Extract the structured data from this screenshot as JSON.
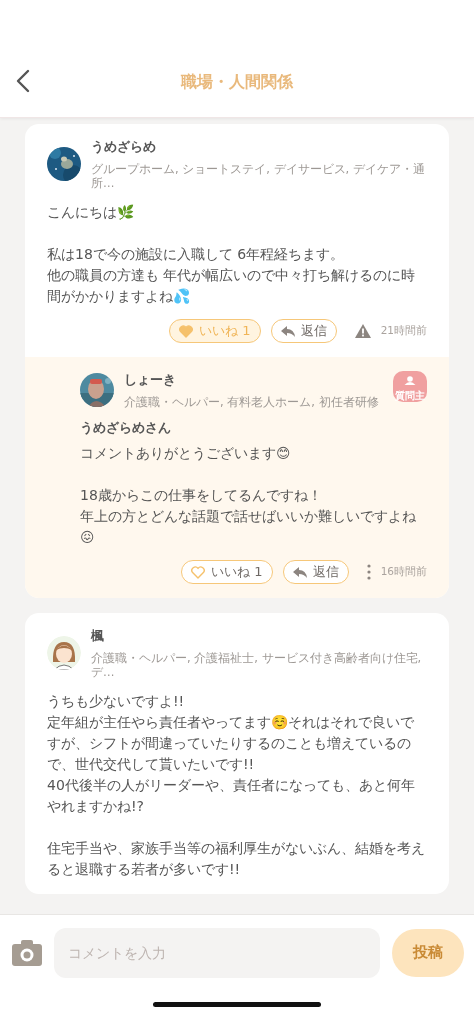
{
  "header": {
    "title": "職場・人間関係"
  },
  "posts": [
    {
      "author": "うめざらめ",
      "avatar": {
        "kind": "picture"
      },
      "tags": "グループホーム, ショートステイ, デイサービス, デイケア・通所…",
      "body": [
        [
          "こんにちは🌿"
        ],
        [
          "私は18で今の施設に入職して 6年程経ちます。",
          "他の職員の方達も 年代が幅広いので中々打ち解けるのに時間がかかりますよね💦"
        ]
      ],
      "like": {
        "label": "いいね 1",
        "liked": true
      },
      "reply": "返信",
      "time": "21時間前",
      "replies": [
        {
          "author": "しょーき",
          "avatar": {
            "kind": "picture"
          },
          "tags": "介護職・ヘルパー, 有料老人ホーム, 初任者研修",
          "is_questioner": true,
          "badge": "質問主",
          "mention": "うめざらめさん",
          "body": [
            [
              "コメントありがとうございます😊"
            ],
            [
              "18歳からこの仕事をしてるんですね！",
              "年上の方とどんな話題で話せばいいか難しいですよね😖"
            ]
          ],
          "like": {
            "label": "いいね 1",
            "liked": false
          },
          "reply": "返信",
          "time": "16時間前"
        }
      ]
    },
    {
      "author": "楓",
      "avatar": {
        "kind": "illustration"
      },
      "tags": "介護職・ヘルパー, 介護福祉士, サービス付き高齢者向け住宅, デ…",
      "body": [
        [
          "うちも少ないですよ!!",
          "定年組が主任やら責任者やってます☺️それはそれで良いですが、シフトが間違っていたりするのことも増えているので、世代交代して貰いたいです!!",
          "40代後半の人がリーダーや、責任者になっても、あと何年やれますかね!?"
        ],
        [
          "住宅手当や、家族手当等の福利厚生がないぶん、結婚を考えると退職する若者が多いです!!"
        ]
      ]
    }
  ],
  "composer": {
    "placeholder": "コメントを入力",
    "submit": "投稿",
    "submit_enabled": false
  }
}
